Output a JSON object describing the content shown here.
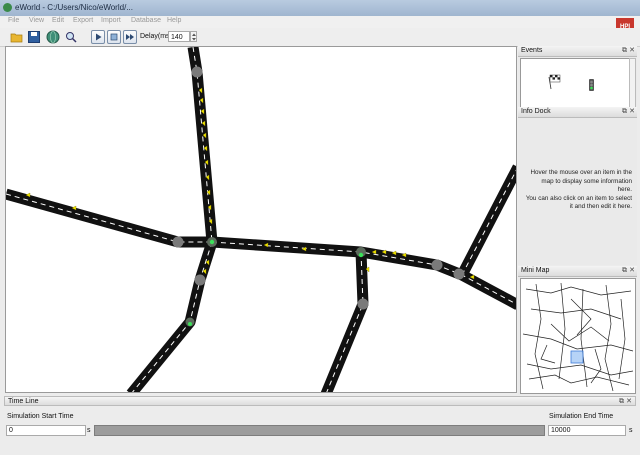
{
  "window": {
    "title": "eWorld - C:/Users/Nico/eWorld/..."
  },
  "menu": [
    "File",
    "View",
    "Edit",
    "Export",
    "Import",
    "Database",
    "Help"
  ],
  "logo": {
    "text": "HPI",
    "color": "#c8372d"
  },
  "toolbar": {
    "delay_label": "Delay(ms):",
    "delay_value": "140",
    "icons": [
      "open-folder-icon",
      "save-icon",
      "globe-icon",
      "zoom-icon",
      "play-icon",
      "stop-icon",
      "pause-icon"
    ]
  },
  "events": {
    "title": "Events"
  },
  "info_dock": {
    "title": "Info Dock",
    "text_lines": [
      "Hover the mouse over an item in the",
      "map to display some information",
      "here.",
      "You can also click on an item to select",
      "it and then edit it here."
    ]
  },
  "mini_map": {
    "title": "Mini Map"
  },
  "timeline": {
    "title": "Time Line",
    "start_label": "Simulation Start Time",
    "start_value": "0",
    "start_unit": "s",
    "end_label": "Simulation End Time",
    "end_value": "10000",
    "end_unit": "s"
  },
  "colors": {
    "road": "#111111",
    "lane_marking": "#ffffff",
    "vehicle": "#f2e600",
    "junction": "#7a7a7a",
    "accent": "#c8372d"
  }
}
